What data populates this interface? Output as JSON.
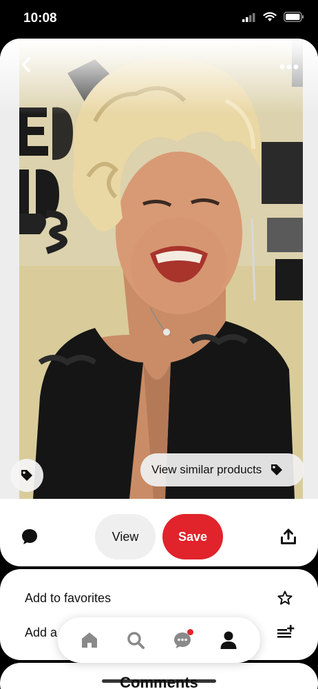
{
  "status_bar": {
    "time": "10:08"
  },
  "pin": {
    "image_alt": "Blonde curly-haired woman grimacing in black ruffled top",
    "similar_products_label": "View similar products"
  },
  "actions": {
    "view_label": "View",
    "save_label": "Save"
  },
  "menu": {
    "favorites_label": "Add to favorites",
    "add_label": "Add a"
  },
  "comments": {
    "title": "Comments"
  },
  "nav": {
    "items": [
      "home-icon",
      "search-icon",
      "messages-icon",
      "profile-icon"
    ]
  },
  "colors": {
    "save_red": "#e1232b",
    "button_gray": "#efefef"
  }
}
